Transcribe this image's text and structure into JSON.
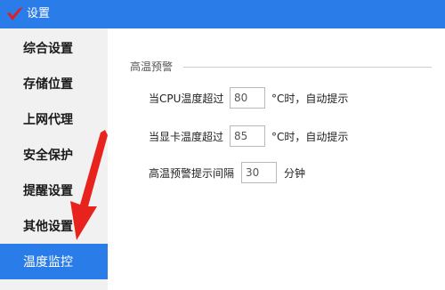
{
  "window": {
    "title": "设置",
    "logo_icon": "checkmark-logo-icon"
  },
  "sidebar": {
    "items": [
      {
        "label": "综合设置",
        "active": false
      },
      {
        "label": "存储位置",
        "active": false
      },
      {
        "label": "上网代理",
        "active": false
      },
      {
        "label": "安全保护",
        "active": false
      },
      {
        "label": "提醒设置",
        "active": false
      },
      {
        "label": "其他设置",
        "active": false
      },
      {
        "label": "温度监控",
        "active": true
      }
    ]
  },
  "main": {
    "section_title": "高温预警",
    "cpu_row": {
      "label": "当CPU温度超过",
      "value": "80",
      "suffix": "°C时，自动提示"
    },
    "gpu_row": {
      "label": "当显卡温度超过",
      "value": "85",
      "suffix": "°C时，自动提示"
    },
    "interval_row": {
      "label": "高温预警提示间隔",
      "value": "30",
      "suffix": "分钟"
    }
  },
  "colors": {
    "accent": "#2a7de8",
    "sidebar_bg": "#f1f1f1",
    "annotation_arrow": "#e8221c",
    "logo_red": "#e02020"
  }
}
